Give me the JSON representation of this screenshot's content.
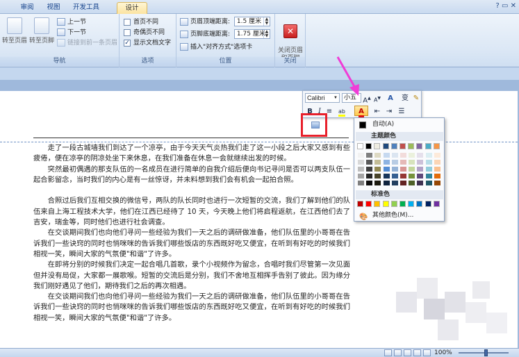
{
  "tabs": [
    {
      "label": "审阅",
      "active": false
    },
    {
      "label": "视图",
      "active": false
    },
    {
      "label": "开发工具",
      "active": false
    },
    {
      "label": "设计",
      "active": true
    }
  ],
  "ribbon": {
    "nav_group": {
      "label": "导航",
      "goto_header": "转至页眉",
      "goto_footer": "转至页脚",
      "prev": "上一节",
      "next": "下一节",
      "link_prev": "链接到前一条页眉"
    },
    "options_group": {
      "label": "选项",
      "first_page": "首页不同",
      "odd_even": "奇偶页不同",
      "show_text": "显示文档文字"
    },
    "position_group": {
      "label": "位置",
      "header_top": "页眉顶端距离:",
      "header_top_value": "1.5 厘米",
      "footer_bottom": "页脚底端距离:",
      "footer_bottom_value": "1.75 厘米",
      "insert_align_tab": "插入\"对齐方式\"选项卡"
    },
    "close_group": {
      "label": "关闭",
      "close_button": "关闭页眉\n和页脚"
    }
  },
  "mini_toolbar": {
    "font": "Calibri",
    "size": "小五",
    "grow": "A",
    "shrink": "A",
    "style": "A",
    "phonetic": "变",
    "bold": "B",
    "italic": "I",
    "center": "≡",
    "highlight": "ab",
    "font_color": "A"
  },
  "color_menu": {
    "auto_label": "自动(A)",
    "theme_label": "主题颜色",
    "standard_label": "标准色",
    "more_colors": "其他颜色(M)...",
    "theme_colors": [
      "#ffffff",
      "#000000",
      "#eeece1",
      "#1f497d",
      "#4f81bd",
      "#c0504d",
      "#9bbb59",
      "#8064a2",
      "#4bacc6",
      "#f79646"
    ],
    "theme_shades": [
      [
        "#f2f2f2",
        "#7f7f7f",
        "#ddd9c3",
        "#c6d9f0",
        "#dbe5f1",
        "#f2dcdb",
        "#ebf1dd",
        "#e5e0ec",
        "#dbeef3",
        "#fdeada"
      ],
      [
        "#d8d8d8",
        "#595959",
        "#c4bd97",
        "#8db3e2",
        "#b8cce4",
        "#e5b9b7",
        "#d7e3bc",
        "#ccc1d9",
        "#b7dde8",
        "#fbd5b5"
      ],
      [
        "#bfbfbf",
        "#3f3f3f",
        "#938953",
        "#548dd4",
        "#95b3d7",
        "#d99694",
        "#c3d69b",
        "#b2a2c7",
        "#92cddc",
        "#fac08f"
      ],
      [
        "#a5a5a5",
        "#262626",
        "#494429",
        "#17365d",
        "#366092",
        "#953734",
        "#76923c",
        "#5f497a",
        "#31859b",
        "#e36c09"
      ],
      [
        "#7f7f7f",
        "#0c0c0c",
        "#1d1b10",
        "#0f243e",
        "#244061",
        "#632423",
        "#4f6128",
        "#3f3151",
        "#205867",
        "#974806"
      ]
    ],
    "standard_colors": [
      "#c00000",
      "#ff0000",
      "#ffc000",
      "#ffff00",
      "#92d050",
      "#00b050",
      "#00b0f0",
      "#0070c0",
      "#002060",
      "#7030a0"
    ]
  },
  "document": {
    "paragraphs": [
      "走了一段古城墙我们到达了一个凉亭，由于今天天气炎热我们走了这一小段之后大家又感到有些疲倦，便在凉亭的阴凉处坐下来休息，在我们准备在休息一会就继续出发的时候。",
      "突然最初偶遇的那支队伍的一名成员在进行简单的自我介绍后便向书记寻问是否可以两支队伍一起合影留念，当时我们的内心是有一丝惊讶，并未料想到我们会有机会一起拍合照。",
      "",
      "合照过后我们互相交换的微信号，两队的队长同时也进行一次短暂的交流，我们了解到他们的队伍来自上海工程技术大学，他们在江西已经待了 10 天，今天晚上他们将启程返航，在江西他们去了吉安，瑞金等，同时他们也进行社会调查。",
      "在交谈期间我们也向他们寻问一些经验为我们一天之后的调研做准备，他们队伍里的小哥哥在告诉我们一些诀窍的同时也悄咪咪的告诉我们哪些饭店的东西既好吃又便宜，在听到有好吃的时候我们相视一笑，瞬间大家的气氛便\"和谐\"了许多。",
      "在即将分别的时候我们决定一起合唱几首歌，录个小视频作为留念，合唱时我们尽管第一次见面但并没有局促，大家都一展歌喉。短暂的交流后是分别，我们不舍地互相挥手告别了彼此。因为缘分我们刚好遇见了他们，期待我们之后的再次相遇。",
      "在交谈期间我们也向他们寻问一些经验为我们一天之后的调研做准备，他们队伍里的小哥哥在告诉我们一些诀窍的同时也悄咪咪的告诉我们哪些饭店的东西既好吃又便宜，在听到有好吃的时候我们相视一笑，瞬间大家的气氛便\"和谐\"了许多。"
    ]
  },
  "status": {
    "zoom": "100%"
  }
}
